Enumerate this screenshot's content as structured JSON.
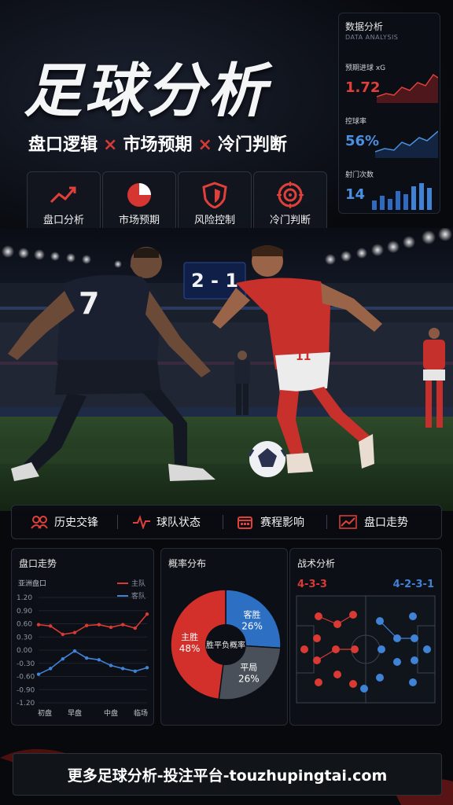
{
  "hero": {
    "title": "足球分析",
    "subtitle": [
      "盘口逻辑",
      "市场预期",
      "冷门判断"
    ],
    "separator": "×"
  },
  "features": [
    {
      "label": "盘口分析",
      "icon": "trend-chart-icon"
    },
    {
      "label": "市场预期",
      "icon": "pie-chart-icon"
    },
    {
      "label": "风险控制",
      "icon": "shield-icon"
    },
    {
      "label": "冷门判断",
      "icon": "target-icon"
    }
  ],
  "data_analysis": {
    "title": "数据分析",
    "title_en": "DATA ANALYSIS",
    "metrics": [
      {
        "label": "预期进球 xG",
        "value": "1.72",
        "color": "#e0403a"
      },
      {
        "label": "控球率",
        "value": "56%",
        "color": "#4b8fe0"
      },
      {
        "label": "射门次数",
        "value": "14",
        "color": "#4b8fe0"
      }
    ]
  },
  "scoreboard": {
    "score": "2 - 1"
  },
  "players": {
    "left_number": "7",
    "right_number": "11"
  },
  "tabs": [
    {
      "label": "历史交锋",
      "icon": "team-icon"
    },
    {
      "label": "球队状态",
      "icon": "pulse-icon"
    },
    {
      "label": "赛程影响",
      "icon": "calendar-icon"
    },
    {
      "label": "盘口走势",
      "icon": "trend-icon"
    }
  ],
  "odds_panel": {
    "title": "盘口走势",
    "subtitle": "亚洲盘口",
    "legend": [
      {
        "name": "主队",
        "color": "#d93a34"
      },
      {
        "name": "客队",
        "color": "#3f82d6"
      }
    ]
  },
  "prob_panel": {
    "title": "概率分布",
    "center_label": "胜平负概率",
    "slices": [
      {
        "label": "主胜",
        "value": 48,
        "display": "48%",
        "color": "#d3302c"
      },
      {
        "label": "客胜",
        "value": 26,
        "display": "26%",
        "color": "#2d6fc2"
      },
      {
        "label": "平局",
        "value": 26,
        "display": "26%",
        "color": "#4a5059"
      }
    ]
  },
  "tactics_panel": {
    "title": "战术分析",
    "home_formation": "4-3-3",
    "away_formation": "4-2-3-1",
    "home_color": "#d93a34",
    "away_color": "#3f82d6"
  },
  "chart_data": {
    "type": "line",
    "title": "盘口走势",
    "subtitle": "亚洲盘口",
    "categories": [
      "初盘",
      "早盘",
      "中盘",
      "临场"
    ],
    "yticks": [
      "1.20",
      "0.90",
      "0.60",
      "0.30",
      "0.00",
      "-0.30",
      "-0.60",
      "-0.90",
      "-1.20"
    ],
    "ylim": [
      -1.2,
      1.2
    ],
    "x": [
      0,
      0.33,
      0.67,
      1,
      1.33,
      1.67,
      2,
      2.33,
      2.67,
      3
    ],
    "series": [
      {
        "name": "主队",
        "color": "#d93a34",
        "values": [
          0.58,
          0.55,
          0.36,
          0.4,
          0.56,
          0.58,
          0.52,
          0.58,
          0.5,
          0.82
        ]
      },
      {
        "name": "客队",
        "color": "#3f82d6",
        "values": [
          -0.55,
          -0.42,
          -0.2,
          -0.02,
          -0.18,
          -0.22,
          -0.35,
          -0.42,
          -0.48,
          -0.4
        ]
      }
    ],
    "grid": true,
    "legend": "top-right"
  },
  "footer": {
    "text": "更多足球分析-投注平台-touzhupingtai.com"
  }
}
